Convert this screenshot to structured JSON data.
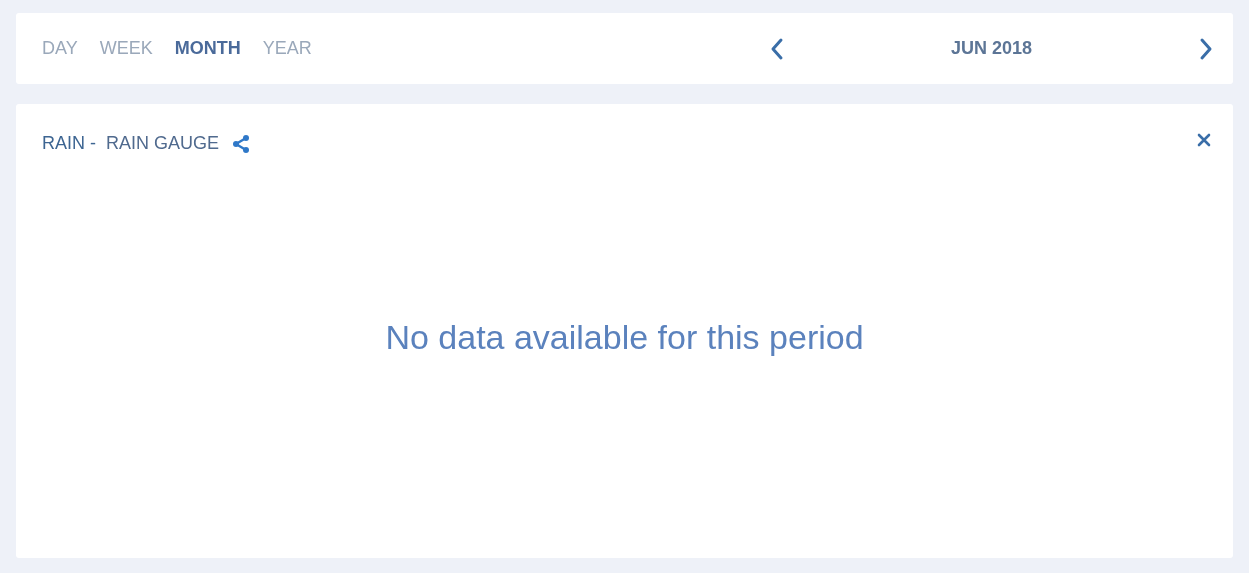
{
  "toolbar": {
    "tabs": [
      {
        "label": "DAY",
        "selected": false
      },
      {
        "label": "WEEK",
        "selected": false
      },
      {
        "label": "MONTH",
        "selected": true
      },
      {
        "label": "YEAR",
        "selected": false
      }
    ],
    "period": "JUN 2018"
  },
  "panel": {
    "sensor": "RAIN -",
    "name": "RAIN GAUGE",
    "message": "No data available for this period"
  }
}
